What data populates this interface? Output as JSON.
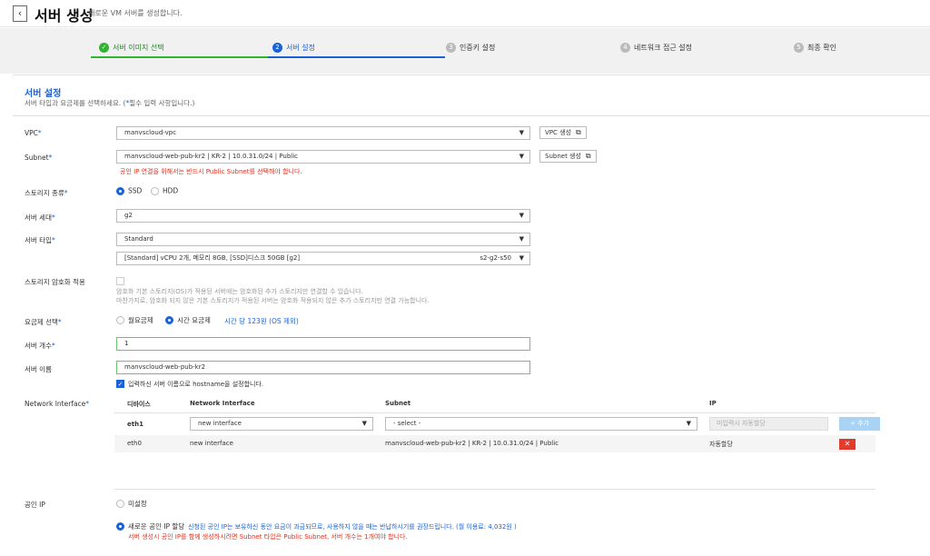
{
  "header": {
    "back_icon": "chevron-left-icon",
    "title": "서버 생성",
    "subtitle": "새로운 VM 서버를 생성합니다."
  },
  "steps": [
    {
      "num": "✓",
      "label": "서버 이미지 선택",
      "state": "done"
    },
    {
      "num": "2",
      "label": "서버 설정",
      "state": "active"
    },
    {
      "num": "3",
      "label": "인증키 설정",
      "state": "pending"
    },
    {
      "num": "4",
      "label": "네트워크 접근 설정",
      "state": "pending"
    },
    {
      "num": "5",
      "label": "최종 확인",
      "state": "pending"
    }
  ],
  "section": {
    "title": "서버 설정",
    "desc_prefix": "서버 타입과 요금제를 선택하세요. (",
    "desc_star": "*",
    "desc_suffix": "필수 입력 사항입니다.)"
  },
  "required_mark": "*",
  "caret": "▼",
  "fields": {
    "vpc": {
      "label": "VPC",
      "value": "manvscloud-vpc",
      "button": "VPC 생성"
    },
    "subnet": {
      "label": "Subnet",
      "value": "manvscloud-web-pub-kr2 | KR-2 | 10.0.31.0/24 | Public",
      "button": "Subnet 생성",
      "error": "공인 IP 연결을 위해서는 반드시 Public Subnet를 선택해야 합니다."
    },
    "storage_type": {
      "label": "스토리지 종류",
      "options": [
        "SSD",
        "HDD"
      ],
      "selected": "SSD"
    },
    "server_gen": {
      "label": "서버 세대",
      "value": "g2"
    },
    "server_type": {
      "label": "서버 타입",
      "value": "Standard",
      "spec": "[Standard] vCPU 2개, 메모리 8GB, [SSD]디스크 50GB [g2]",
      "spec_code": "s2-g2-s50"
    },
    "storage_encrypt": {
      "label": "스토리지 암호화 적용",
      "hint1": "암호화 기본 스토리지(OS)가 적용된 서버에는 암호화된 추가 스토리지만 연결할 수 있습니다.",
      "hint2": "마찬가지로, 암호화 되지 않은 기본 스토리지가 적용된 서버는 암호화 적용되지 않은 추가 스토리지만 연결 가능합니다."
    },
    "billing": {
      "label": "요금제 선택",
      "options": [
        "월요금제",
        "시간 요금제"
      ],
      "selected": "시간 요금제",
      "price": "시간 당 123원 (OS 제외)"
    },
    "server_count": {
      "label": "서버 개수",
      "value": "1"
    },
    "server_name": {
      "label": "서버 이름",
      "value": "manvscloud-web-pub-kr2",
      "checkbox_label": "입력하신 서버 이름으로 hostname을 설정합니다."
    }
  },
  "network_interface": {
    "label": "Network Interface",
    "columns": [
      "디바이스",
      "Network Interface",
      "Subnet",
      "IP"
    ],
    "new_row": {
      "device": "eth1",
      "interface": "new interface",
      "subnet": "- select -",
      "ip_placeholder": "미입력시 자동할당",
      "add_label": "+ 추가"
    },
    "rows": [
      {
        "device": "eth0",
        "interface": "new interface",
        "subnet": "manvscloud-web-pub-kr2 | KR-2 | 10.0.31.0/24 | Public",
        "ip": "자동할당",
        "delete": "✕"
      }
    ]
  },
  "public_ip": {
    "label": "공인 IP",
    "option_none": "미설정",
    "option_new": "새로운 공인 IP 할당",
    "desc": "신청된 공인 IP는 보유하신 동안 요금이 과금되므로, 사용하지 않을 때는 반납하시기를 권장드립니다. (월 이용료: 4,032원 )",
    "warn": "서버 생성시 공인 IP를 함께 생성하시려면 Subnet 타입은 Public Subnet, 서버 개수는 1개여야 합니다."
  },
  "colors": {
    "primary": "#1a62d6",
    "success": "#2fb52f",
    "error": "#e0301e"
  }
}
